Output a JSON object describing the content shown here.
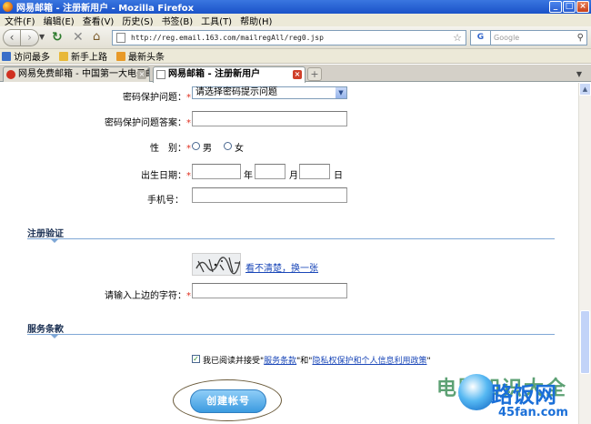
{
  "window": {
    "title": "网易邮箱 - 注册新用户 - Mozilla Firefox",
    "controls": [
      "_",
      "□",
      "×"
    ]
  },
  "menu": [
    "文件(F)",
    "编辑(E)",
    "查看(V)",
    "历史(S)",
    "书签(B)",
    "工具(T)",
    "帮助(H)"
  ],
  "toolbar": {
    "url": "http://reg.email.163.com/mailregAll/reg0.jsp",
    "search_placeholder": "Google",
    "search_engine": "G"
  },
  "bookmarks": [
    "访问最多",
    "新手上路",
    "最新头条"
  ],
  "tabs": [
    {
      "label": "网易免费邮箱 - 中国第一大电子邮…"
    },
    {
      "label": "网易邮箱 - 注册新用户"
    }
  ],
  "new_tab": "+",
  "form": {
    "security_question_label": "密码保护问题：",
    "security_question_value": "请选择密码提示问题",
    "security_answer_label": "密码保护问题答案：",
    "gender_label": "性　别：",
    "gender_male": "男",
    "gender_female": "女",
    "birthday_label": "出生日期：",
    "year_unit": "年",
    "month_unit": "月",
    "day_unit": "日",
    "phone_label": "手机号：",
    "required_mark": "*"
  },
  "verification": {
    "section_title": "注册验证",
    "captcha_text": "度··千",
    "refresh_link": "看不清楚，换一张",
    "code_label": "请输入上边的字符："
  },
  "terms": {
    "section_title": "服务条款",
    "agree_prefix": "我已阅读并接受\"",
    "terms_link": "服务条款",
    "middle": "\"和\"",
    "privacy_link": "隐私权保护和个人信息利用政策",
    "agree_suffix": "\""
  },
  "actions": {
    "create_account": "创建帐号"
  },
  "watermark": {
    "text": "路饭网",
    "url": "45fan.com",
    "faint": "电脑知识大全"
  }
}
